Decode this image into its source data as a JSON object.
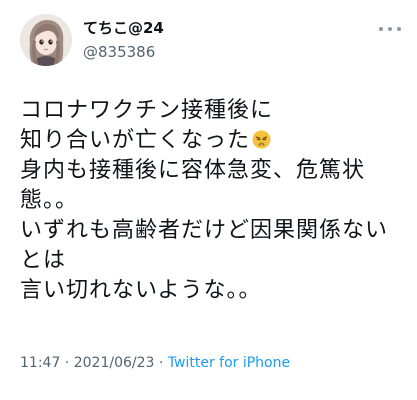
{
  "user": {
    "display_name": "てちこ@24",
    "handle": "@835386",
    "avatar": "anime-girl-avatar-icon"
  },
  "tweet": {
    "lines": [
      "コロナワクチン接種後に",
      "知り合いが亡くなった",
      "身内も接種後に容体急変、危篤状",
      "態。。",
      "いずれも高齢者だけど因果関係ない",
      "とは",
      "言い切れないような。。"
    ],
    "emoji": "weary-face-emoji"
  },
  "meta": {
    "time": "11:47",
    "separator1": " · ",
    "date": "2021/06/23",
    "separator2": " · ",
    "source": "Twitter for iPhone"
  },
  "colors": {
    "text": "#0f1419",
    "secondary": "#536471",
    "link": "#1d9bf0",
    "emoji": "#f6c23c"
  }
}
